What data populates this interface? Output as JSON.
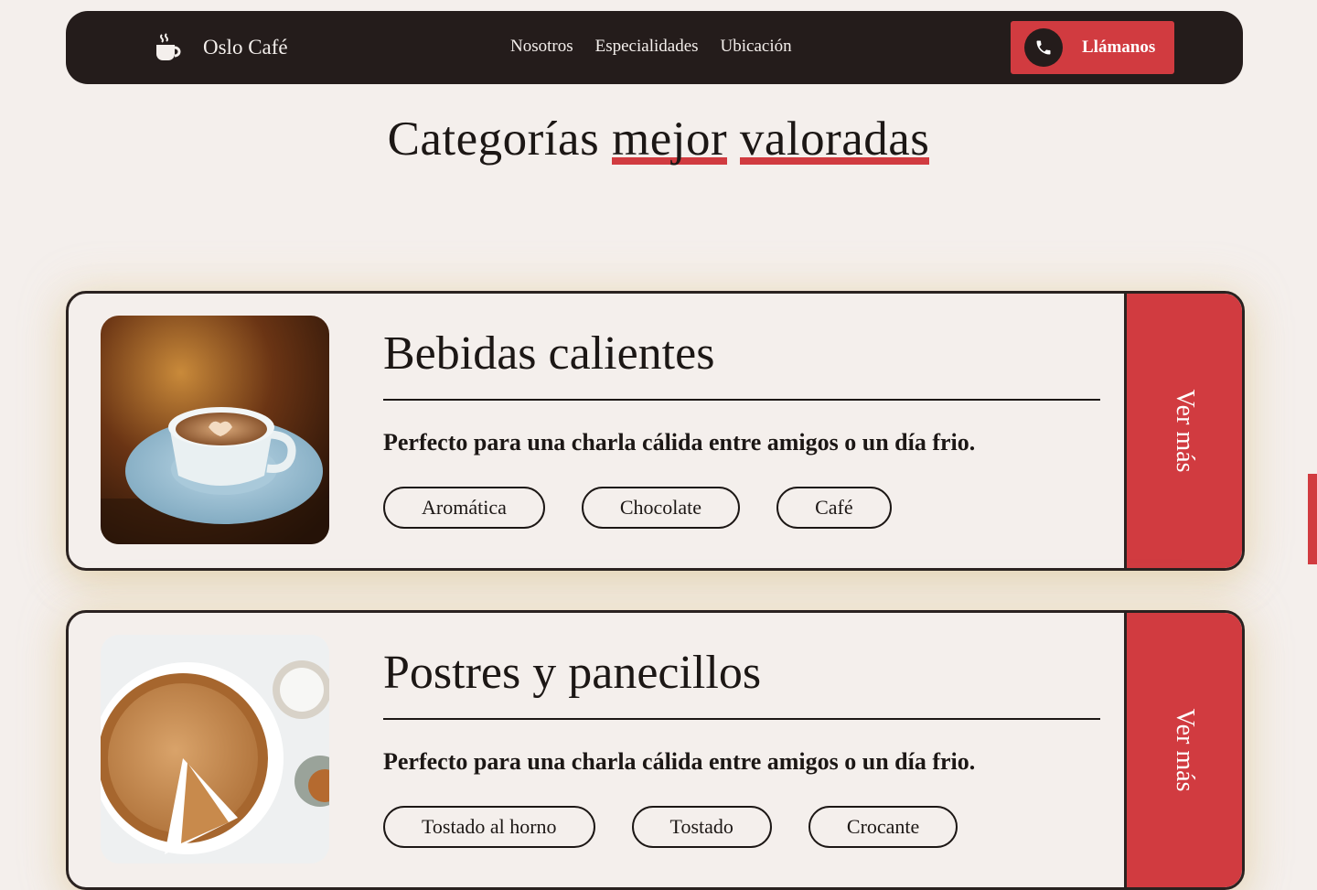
{
  "nav": {
    "brand": "Oslo Café",
    "brand_icon": "coffee-cup-icon",
    "links": [
      "Nosotros",
      "Especialidades",
      "Ubicación"
    ],
    "call_label": "Llámanos",
    "call_icon": "phone-icon"
  },
  "heading": {
    "part1": "Categorías",
    "part2": "mejor",
    "part3": "valoradas"
  },
  "cards": [
    {
      "title": "Bebidas calientes",
      "description": "Perfecto para una charla cálida entre amigos o un día frio.",
      "tags": [
        "Aromática",
        "Chocolate",
        "Café"
      ],
      "action": "Ver más",
      "image": "coffee-cup-photo"
    },
    {
      "title": "Postres y panecillos",
      "description": "Perfecto para una charla cálida entre amigos o un día frio.",
      "tags": [
        "Tostado al horno",
        "Tostado",
        "Crocante"
      ],
      "action": "Ver más",
      "image": "pie-photo"
    }
  ],
  "colors": {
    "background": "#f4efec",
    "dark": "#241c1b",
    "accent": "#d13b40"
  }
}
